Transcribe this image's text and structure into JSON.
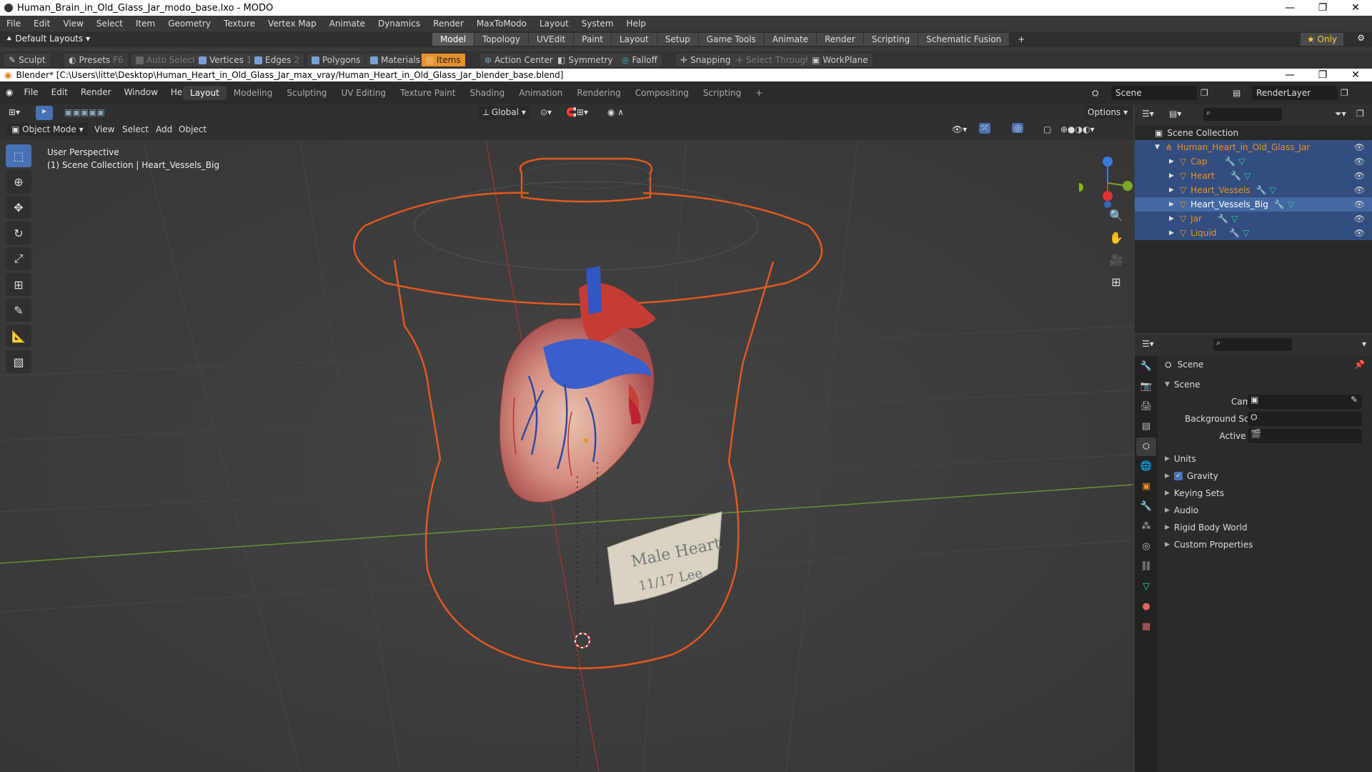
{
  "modo": {
    "title": "Human_Brain_in_Old_Glass_Jar_modo_base.lxo - MODO",
    "menu": [
      "File",
      "Edit",
      "View",
      "Select",
      "Item",
      "Geometry",
      "Texture",
      "Vertex Map",
      "Animate",
      "Dynamics",
      "Render",
      "MaxToModo",
      "Layout",
      "System",
      "Help"
    ],
    "layouts_label": "Default Layouts",
    "tabs": [
      "Model",
      "Topology",
      "UVEdit",
      "Paint",
      "Layout",
      "Setup",
      "Game Tools",
      "Animate",
      "Render",
      "Scripting",
      "Schematic Fusion"
    ],
    "only_label": "Only",
    "tools": {
      "sculpt": "Sculpt",
      "presets": "Presets",
      "presets_key": "F6",
      "auto_select": "Auto Select",
      "vertices": "Vertices",
      "vertices_count": "1",
      "edges": "Edges",
      "edges_count": "2",
      "polygons": "Polygons",
      "materials": "Materials",
      "items": "Items",
      "action_center": "Action Center",
      "symmetry": "Symmetry",
      "falloff": "Falloff",
      "snapping": "Snapping",
      "select_through": "Select Through",
      "workplane": "WorkPlane"
    }
  },
  "blender": {
    "title": "Blender* [C:\\Users\\litte\\Desktop\\Human_Heart_in_Old_Glass_Jar_max_vray/Human_Heart_in_Old_Glass_Jar_blender_base.blend]",
    "menu": [
      "File",
      "Edit",
      "Render",
      "Window",
      "Help"
    ],
    "workspaces": [
      "Layout",
      "Modeling",
      "Sculpting",
      "UV Editing",
      "Texture Paint",
      "Shading",
      "Animation",
      "Rendering",
      "Compositing",
      "Scripting"
    ],
    "scene": "Scene",
    "render_layer": "RenderLayer",
    "header": {
      "mode": "Object Mode",
      "view": "View",
      "select": "Select",
      "add": "Add",
      "object": "Object",
      "orientation": "Global",
      "options": "Options"
    },
    "viewport": {
      "perspective": "User Perspective",
      "collection": "(1) Scene Collection | Heart_Vessels_Big",
      "label_text": "Male Heart",
      "label_date": "11/17 Lee"
    },
    "outliner": {
      "root": "Scene Collection",
      "collection": "Human_Heart_in_Old_Glass_Jar",
      "items": [
        "Cap",
        "Heart",
        "Heart_Vessels",
        "Heart_Vessels_Big",
        "Jar",
        "Liquid"
      ]
    },
    "properties": {
      "breadcrumb": "Scene",
      "panel": "Scene",
      "camera_label": "Camera",
      "bg_scene_label": "Background Scene",
      "active_clip_label": "Active Clip",
      "sections": [
        "Units",
        "Gravity",
        "Keying Sets",
        "Audio",
        "Rigid Body World",
        "Custom Properties"
      ]
    }
  }
}
